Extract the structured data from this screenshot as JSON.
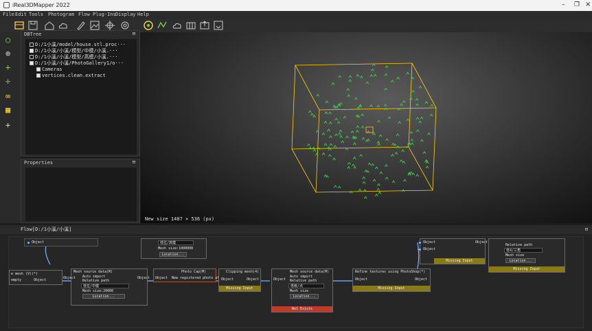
{
  "window": {
    "title": "iReal3DMapper 2022"
  },
  "menu": [
    {
      "label": "File"
    },
    {
      "label": "Edit"
    },
    {
      "label": "Tools"
    },
    {
      "label": "Photogram"
    },
    {
      "label": "Flow"
    },
    {
      "label": "Plug-Ins"
    },
    {
      "label": "Display"
    },
    {
      "label": "Help"
    }
  ],
  "toolbar_icons": [
    "folder-icon",
    "save-icon",
    "house-icon",
    "cloud-icon",
    "pen-icon",
    "image-icon",
    "move-icon",
    "settings-icon",
    "gear-icon",
    "mesh-icon",
    "cloud-icon",
    "grid-icon",
    "export-icon",
    "export-icon"
  ],
  "left_tools": [
    "search-icon",
    "zoom-icon",
    "pan-icon",
    "axis-icon",
    "nodes-icon",
    "table-icon",
    "plus-icon"
  ],
  "tree": {
    "title": "DBTree",
    "items": [
      {
        "label": "D:/1小溪/model/house.stl.proc···",
        "checked": false
      },
      {
        "label": "D:/1小溪/小溪/模型/中模/小溪.···",
        "checked": true
      },
      {
        "label": "D:/1小溪/小溪/模型/高模/小溪.···",
        "checked": false
      },
      {
        "label": "D:/1小溪/小溪/PhotoGallery1/o···",
        "checked": true
      },
      {
        "label": "Cameras",
        "checked": true
      },
      {
        "label": "vertices.clean.extract",
        "checked": true
      }
    ]
  },
  "properties": {
    "title": "Properties"
  },
  "viewport": {
    "status": "New size 1487 × 536 (px)"
  },
  "flow": {
    "title": "Flow[D:/1小溪/小溪]",
    "nodes": [
      {
        "title": "Mesh source data(M)",
        "rows": [
          "Auto import",
          "Relative path",
          "低位/中模",
          "Mesh size:20000",
          "Location..."
        ],
        "inport": "Object",
        "outport": "Object"
      },
      {
        "title": "Photo Cap(M)",
        "rows": [
          "New registered photo album"
        ],
        "inport": "Object",
        "outport": "Object"
      },
      {
        "title": "Clipping mesh(4)",
        "rows": [],
        "inport": "Object",
        "outport": "Object",
        "bar": "Missing Input"
      },
      {
        "title": "Mesh source data(M)",
        "rows": [
          "Auto import",
          "Relative path",
          "低级/点",
          "Mesh size",
          "Location..."
        ],
        "inport": "Object",
        "outport": "Object",
        "bar": "Not Exists"
      },
      {
        "title": "Refine textures using PhotoShop(*)",
        "rows": [
          "Object",
          "Object"
        ],
        "inport": "Object",
        "outport": "Object",
        "bar": "Missing Input"
      },
      {
        "title": "Mesh source data(M)",
        "rows": [
          "Relative path",
          "低4/三角",
          "Mesh size",
          "Location..."
        ],
        "inport": "Object",
        "outport": "Object",
        "bar": "Missing Input"
      },
      {
        "title": "低位/高模",
        "rows": [
          "Mesh size:1000000",
          "Location..."
        ],
        "inport": "",
        "outport": ""
      }
    ],
    "left_ports": [
      "e mesh (V)(*)",
      "empty",
      "Object",
      "Object"
    ],
    "top_ports": [
      "Object",
      "Object",
      "Object",
      "Object",
      "Object"
    ],
    "bars": [
      "Missing Input",
      "Missing Input",
      "Missing Input",
      "Not Exists",
      "Missing Input"
    ]
  },
  "colors": {
    "accent": "#ffd400",
    "error": "#c0392b",
    "warning": "#8a7a17",
    "link": "#7fb6ff"
  }
}
